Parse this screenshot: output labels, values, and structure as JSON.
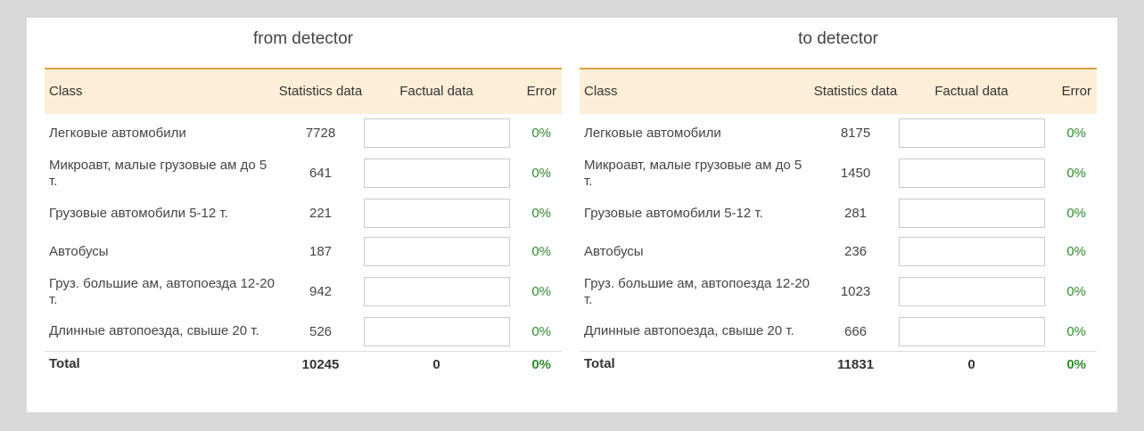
{
  "headers": {
    "class": "Class",
    "statistics": "Statistics data",
    "factual": "Factual data",
    "error": "Error"
  },
  "panels": [
    {
      "title": "from detector",
      "rows": [
        {
          "class": "Легковые автомобили",
          "stat": "7728",
          "factual": "",
          "error": "0%"
        },
        {
          "class": "Микроавт, малые грузовые ам до 5 т.",
          "stat": "641",
          "factual": "",
          "error": "0%"
        },
        {
          "class": "Грузовые автомобили 5-12 т.",
          "stat": "221",
          "factual": "",
          "error": "0%"
        },
        {
          "class": "Автобусы",
          "stat": "187",
          "factual": "",
          "error": "0%"
        },
        {
          "class": "Груз. большие ам, автопоезда 12-20 т.",
          "stat": "942",
          "factual": "",
          "error": "0%"
        },
        {
          "class": "Длинные автопоезда, свыше 20 т.",
          "stat": "526",
          "factual": "",
          "error": "0%"
        }
      ],
      "total": {
        "label": "Total",
        "stat": "10245",
        "factual": "0",
        "error": "0%"
      }
    },
    {
      "title": "to detector",
      "rows": [
        {
          "class": "Легковые автомобили",
          "stat": "8175",
          "factual": "",
          "error": "0%"
        },
        {
          "class": "Микроавт, малые грузовые ам до 5 т.",
          "stat": "1450",
          "factual": "",
          "error": "0%"
        },
        {
          "class": "Грузовые автомобили 5-12 т.",
          "stat": "281",
          "factual": "",
          "error": "0%"
        },
        {
          "class": "Автобусы",
          "stat": "236",
          "factual": "",
          "error": "0%"
        },
        {
          "class": "Груз. большие ам, автопоезда 12-20 т.",
          "stat": "1023",
          "factual": "",
          "error": "0%"
        },
        {
          "class": "Длинные автопоезда, свыше 20 т.",
          "stat": "666",
          "factual": "",
          "error": "0%"
        }
      ],
      "total": {
        "label": "Total",
        "stat": "11831",
        "factual": "0",
        "error": "0%"
      }
    }
  ]
}
